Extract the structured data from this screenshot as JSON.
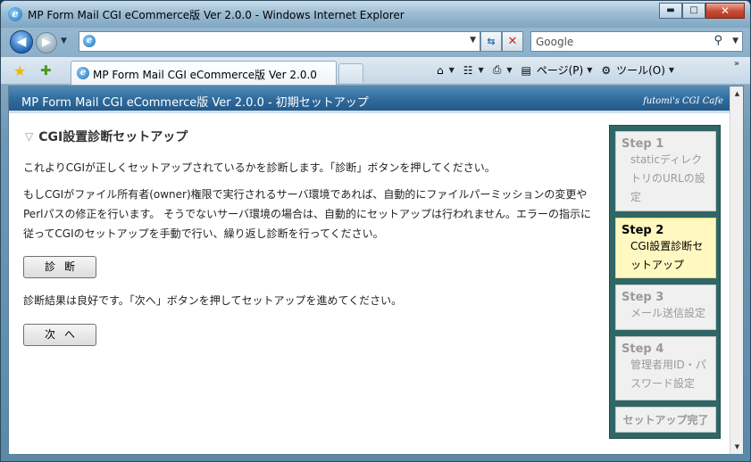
{
  "window": {
    "title": "MP Form Mail CGI eCommerce版 Ver 2.0.0 - Windows Internet Explorer",
    "controls": {
      "minimize": "▬",
      "maximize": "□",
      "close": "✕"
    }
  },
  "navbar": {
    "address_value": "",
    "search_placeholder": "Google"
  },
  "tabs": [
    {
      "label": "MP Form Mail CGI eCommerce版 Ver 2.0.0"
    }
  ],
  "toolbar": {
    "page_label": "ページ(P)",
    "tools_label": "ツール(O)",
    "more": "»"
  },
  "page": {
    "banner_title": "MP Form Mail CGI eCommerce版 Ver 2.0.0 - 初期セットアップ",
    "brand": "futomi's CGI Cafe",
    "heading": "CGI設置診断セットアップ",
    "intro": "これよりCGIが正しくセットアップされているかを診断します。「診断」ボタンを押してください。",
    "description": "もしCGIがファイル所有者(owner)権限で実行されるサーバ環境であれば、自動的にファイルパーミッションの変更やPerlパスの修正を行います。 そうでないサーバ環境の場合は、自動的にセットアップは行われません。エラーの指示に従ってCGIのセットアップを手動で行い、繰り返し診断を行ってください。",
    "diagnose_button": "診断",
    "result": "診断結果は良好です。「次へ」ボタンを押してセットアップを進めてください。",
    "next_button": "次へ"
  },
  "steps": [
    {
      "number": "Step 1",
      "label": "staticディレクトリのURLの設定",
      "active": false
    },
    {
      "number": "Step 2",
      "label": "CGI設置診断セットアップ",
      "active": true
    },
    {
      "number": "Step 3",
      "label": "メール送信設定",
      "active": false
    },
    {
      "number": "Step 4",
      "label": "管理者用ID・パスワード設定",
      "active": false
    },
    {
      "number": "",
      "label": "セットアップ完了",
      "active": false
    }
  ],
  "colors": {
    "banner": "#2f6a9c",
    "steps_panel": "#2f6766",
    "active_step": "#fff8c0"
  }
}
